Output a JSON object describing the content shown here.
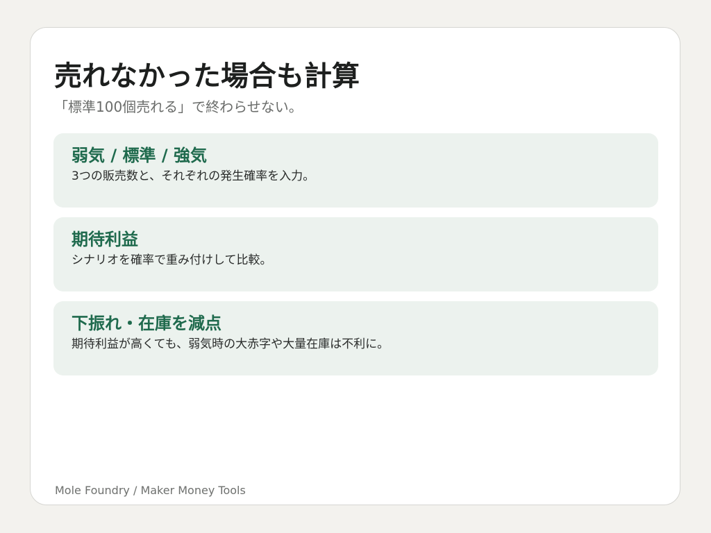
{
  "slide": {
    "title": "売れなかった場合も計算",
    "subtitle": "「標準100個売れる」で終わらせない。",
    "cards": [
      {
        "title": "弱気 / 標準 / 強気",
        "description": "3つの販売数と、それぞれの発生確率を入力。"
      },
      {
        "title": "期待利益",
        "description": "シナリオを確率で重み付けして比較。"
      },
      {
        "title": "下振れ・在庫を減点",
        "description": "期待利益が高くても、弱気時の大赤字や大量在庫は不利に。"
      }
    ],
    "footer": "Mole Foundry / Maker Money Tools"
  },
  "colors": {
    "background": "#f3f2ee",
    "panel": "#ffffff",
    "card": "#ecf2ee",
    "accent": "#1f6a4d",
    "title": "#1d1f1e",
    "muted": "#6a6c6a"
  }
}
